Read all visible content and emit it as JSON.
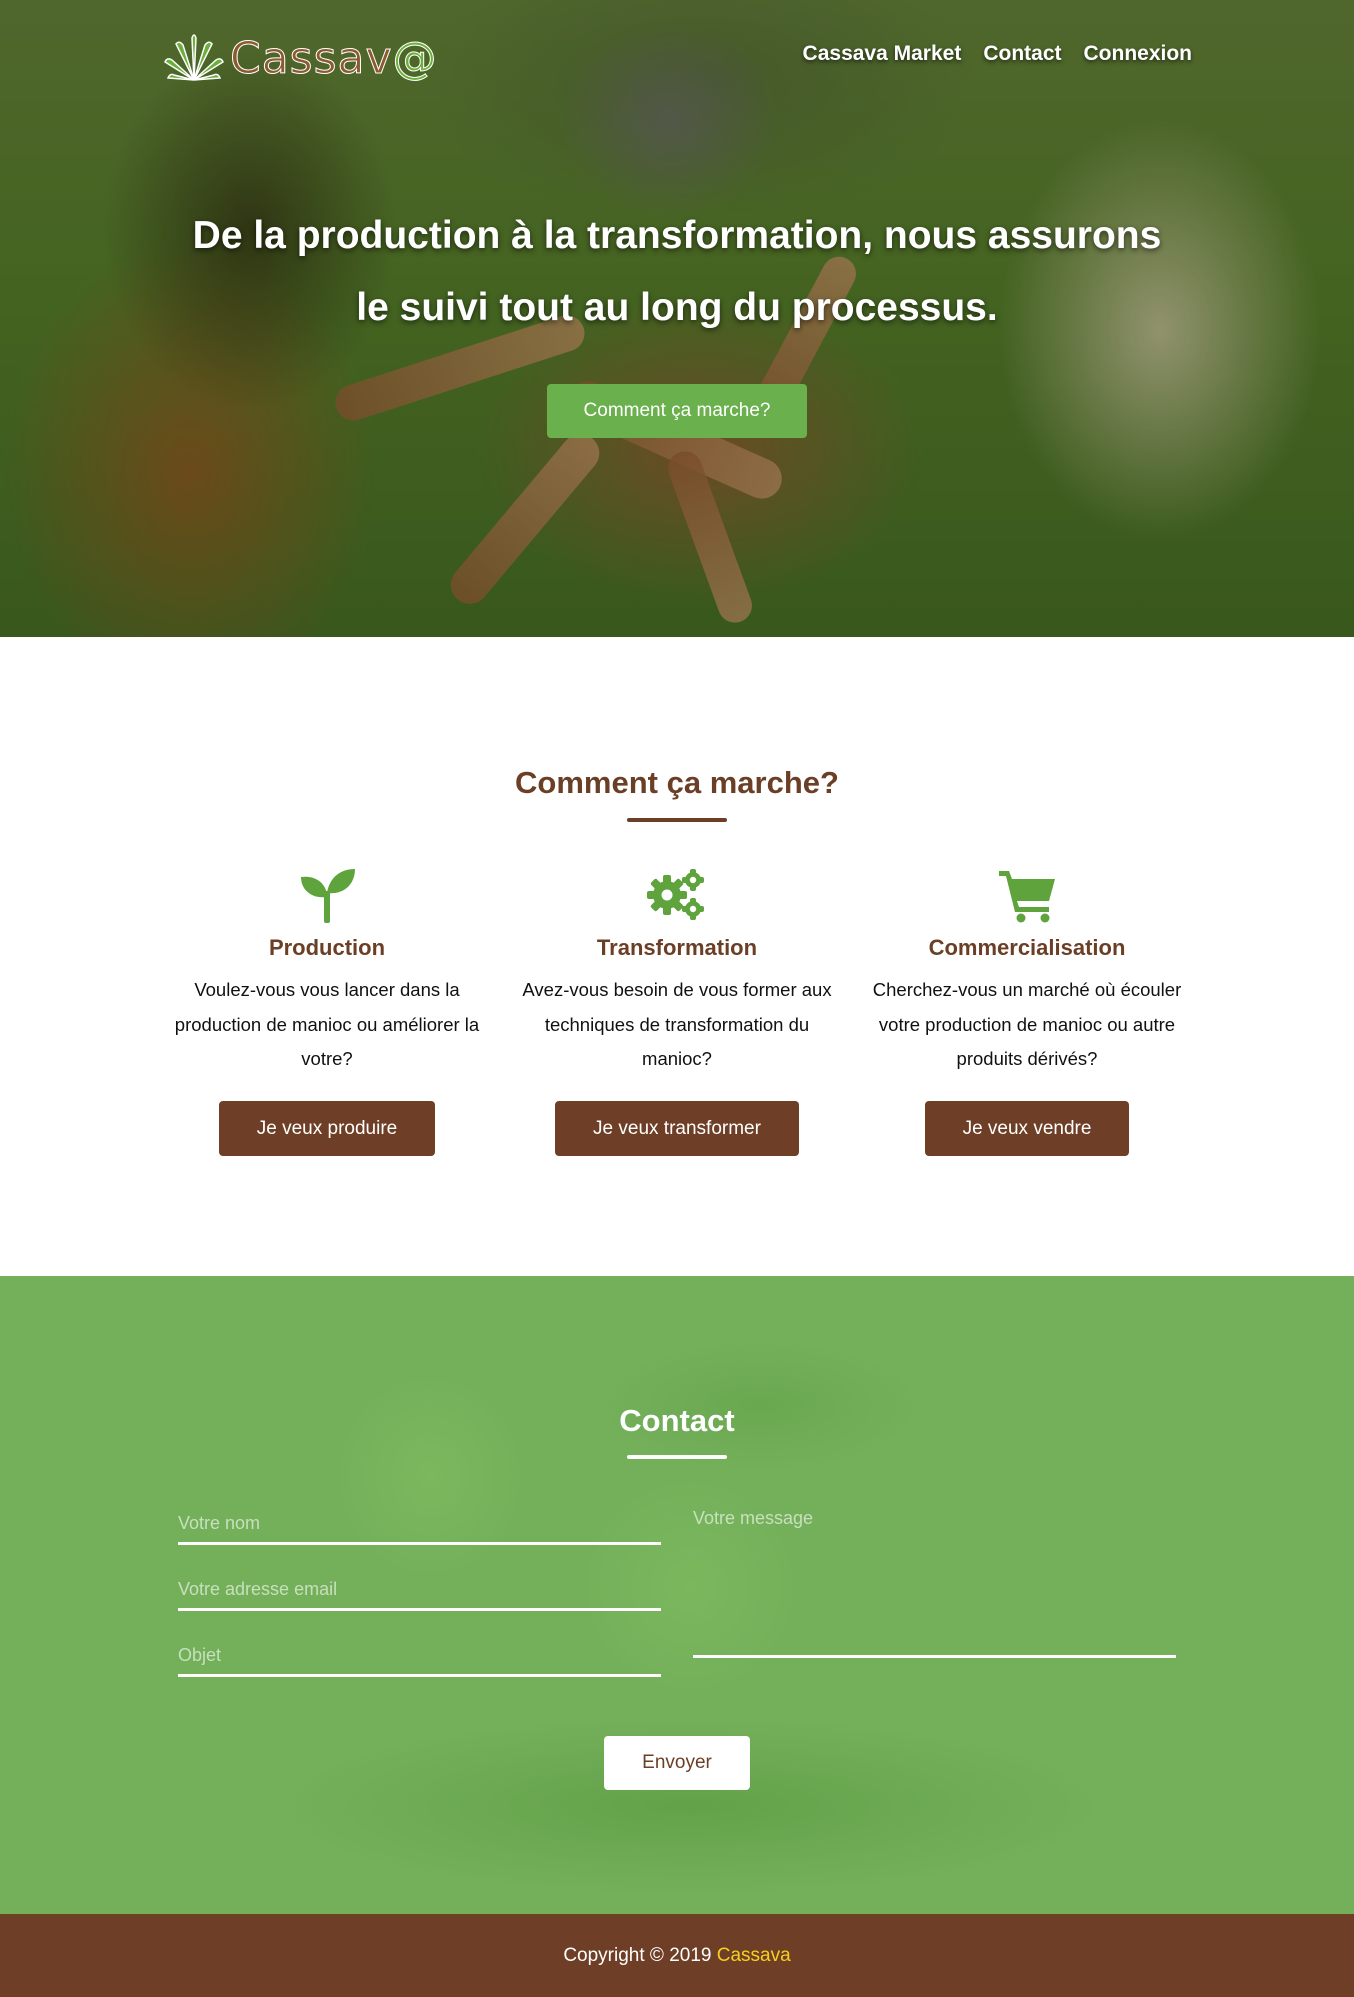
{
  "brand": {
    "logo_text": "Cassav",
    "logo_at": "@"
  },
  "nav": {
    "items": [
      "Cassava Market",
      "Contact",
      "Connexion"
    ]
  },
  "hero": {
    "title": "De la production à la transformation, nous assurons le suivi tout au long du processus.",
    "button": "Comment ça marche?"
  },
  "how": {
    "title": "Comment ça marche?",
    "columns": [
      {
        "icon": "sprout-icon",
        "title": "Production",
        "text": "Voulez-vous vous lancer dans la production de manioc ou améliorer la votre?",
        "button": "Je veux produire"
      },
      {
        "icon": "gears-icon",
        "title": "Transformation",
        "text": "Avez-vous besoin de vous former aux techniques de transformation du manioc?",
        "button": "Je veux transformer"
      },
      {
        "icon": "cart-icon",
        "title": "Commercialisation",
        "text": "Cherchez-vous un marché où écouler votre production de manioc ou autre produits dérivés?",
        "button": "Je veux vendre"
      }
    ]
  },
  "contact": {
    "title": "Contact",
    "name_placeholder": "Votre nom",
    "email_placeholder": "Votre adresse email",
    "subject_placeholder": "Objet",
    "message_placeholder": "Votre message",
    "send": "Envoyer"
  },
  "footer": {
    "copyright": "Copyright © 2019",
    "brand": "Cassava"
  },
  "colors": {
    "brown": "#6e3f26",
    "green": "#6ab04c",
    "contact_bg": "#74b05a",
    "footer_brand": "#f5d020"
  }
}
